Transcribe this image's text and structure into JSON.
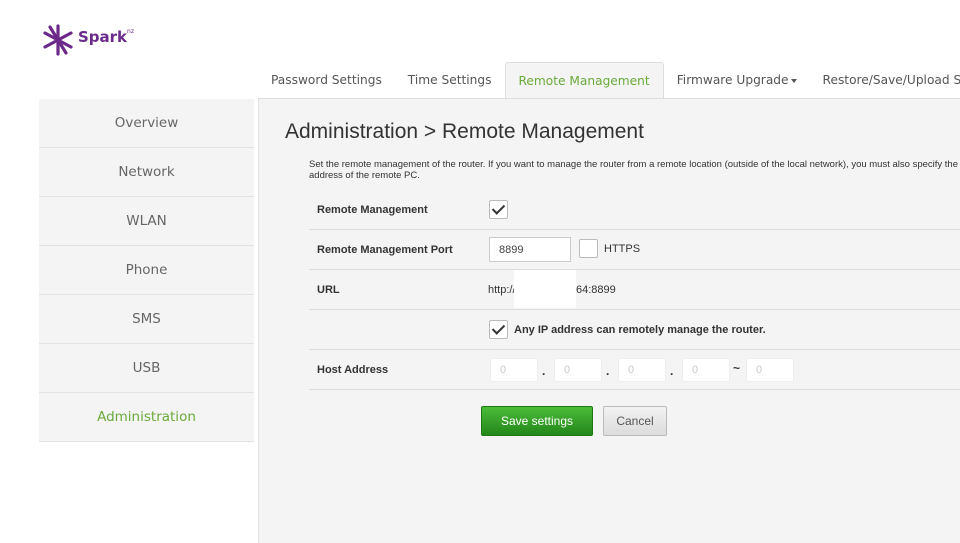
{
  "brand": {
    "name": "Spark",
    "suffix": "nz"
  },
  "tabs": [
    {
      "label": "Password Settings"
    },
    {
      "label": "Time Settings"
    },
    {
      "label": "Remote Management"
    },
    {
      "label": "Firmware Upgrade"
    },
    {
      "label": "Restore/Save/Upload Settings"
    }
  ],
  "sidebar": {
    "items": [
      {
        "label": "Overview"
      },
      {
        "label": "Network"
      },
      {
        "label": "WLAN"
      },
      {
        "label": "Phone"
      },
      {
        "label": "SMS"
      },
      {
        "label": "USB"
      },
      {
        "label": "Administration"
      }
    ]
  },
  "main": {
    "title": "Administration > Remote Management",
    "description_line1": "Set the remote management of the router. If you want to manage the router from a remote location (outside of the local network), you must also specify the IP",
    "description_line2": "address of the remote PC.",
    "remote_management": {
      "label": "Remote Management",
      "checked": true
    },
    "port": {
      "label": "Remote Management Port",
      "value": "8899",
      "https_label": "HTTPS",
      "https_checked": false
    },
    "url": {
      "label": "URL",
      "prefix": "http://",
      "suffix": "64:8899"
    },
    "any_ip": {
      "label": "Any IP address can remotely manage the router.",
      "checked": true
    },
    "host": {
      "label": "Host Address",
      "placeholders": [
        "0",
        "0",
        "0",
        "0",
        "0"
      ],
      "dot": ".",
      "tilde": "~"
    },
    "buttons": {
      "save": "Save settings",
      "cancel": "Cancel"
    }
  },
  "colors": {
    "accent_green": "#6aaa3a",
    "brand_purple": "#6b2a8a",
    "save_green": "#2e9a22"
  }
}
